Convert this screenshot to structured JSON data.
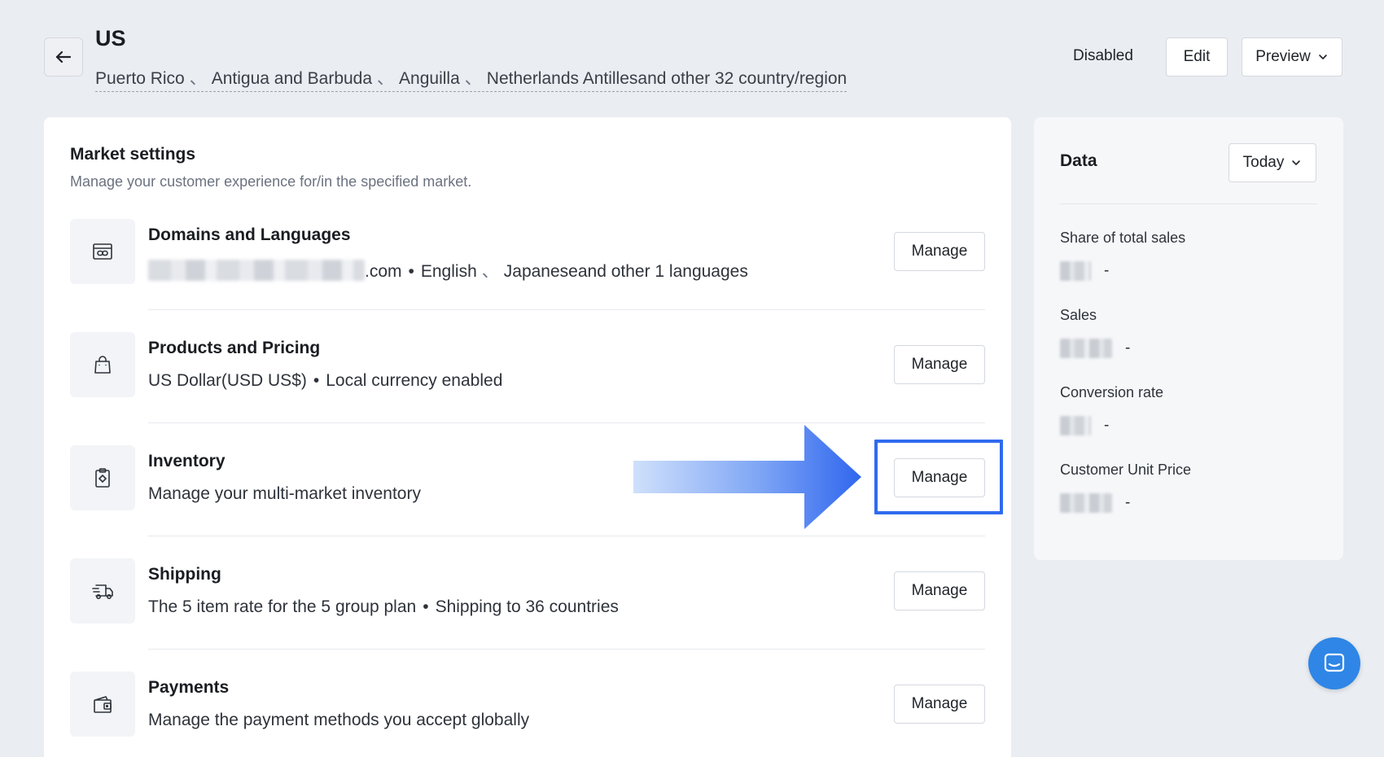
{
  "header": {
    "title": "US",
    "regions": [
      "Puerto Rico",
      "Antigua and Barbuda",
      "Anguilla",
      "Netherlands Antillesand other 32 country/region"
    ],
    "region_separator": "、",
    "status": "Disabled",
    "edit_label": "Edit",
    "preview_label": "Preview"
  },
  "market_settings": {
    "title": "Market settings",
    "subtitle": "Manage your customer experience for/in the specified market.",
    "manage_label": "Manage",
    "rows": [
      {
        "title": "Domains and Languages",
        "icon": "browser-link-icon",
        "domain_suffix": ".com",
        "languages": [
          "English",
          "Japaneseand other 1 languages"
        ]
      },
      {
        "title": "Products and Pricing",
        "icon": "shopping-bag-icon",
        "details": [
          "US Dollar(USD US$)",
          "Local currency enabled"
        ]
      },
      {
        "title": "Inventory",
        "icon": "clipboard-icon",
        "details": [
          "Manage your multi-market inventory"
        ]
      },
      {
        "title": "Shipping",
        "icon": "delivery-truck-icon",
        "details": [
          "The 5 item rate for the 5 group plan",
          "Shipping to 36 countries"
        ]
      },
      {
        "title": "Payments",
        "icon": "wallet-icon",
        "details": [
          "Manage the payment methods you accept globally"
        ]
      }
    ]
  },
  "data_panel": {
    "title": "Data",
    "range_label": "Today",
    "metrics": [
      {
        "label": "Share of total sales",
        "value": "-"
      },
      {
        "label": "Sales",
        "value": "-"
      },
      {
        "label": "Conversion rate",
        "value": "-"
      },
      {
        "label": "Customer Unit Price",
        "value": "-"
      }
    ]
  },
  "annotation": {
    "highlight_color": "#2f6bef",
    "arrow_color": "#3a6ff0"
  },
  "colors": {
    "page_bg": "#eaedf2",
    "card_bg": "#ffffff",
    "chat_bg": "#2f86e6"
  }
}
